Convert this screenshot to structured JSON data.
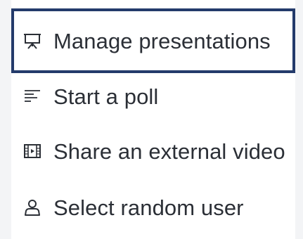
{
  "menu": {
    "items": [
      {
        "label": "Manage presentations",
        "icon": "presentation-icon"
      },
      {
        "label": "Start a poll",
        "icon": "poll-icon"
      },
      {
        "label": "Share an external video",
        "icon": "video-icon"
      },
      {
        "label": "Select random user",
        "icon": "user-icon"
      }
    ],
    "focus_color": "#243b6b",
    "text_color": "#2b2f36",
    "background": "#ffffff",
    "page_background": "#f3f4f6"
  }
}
